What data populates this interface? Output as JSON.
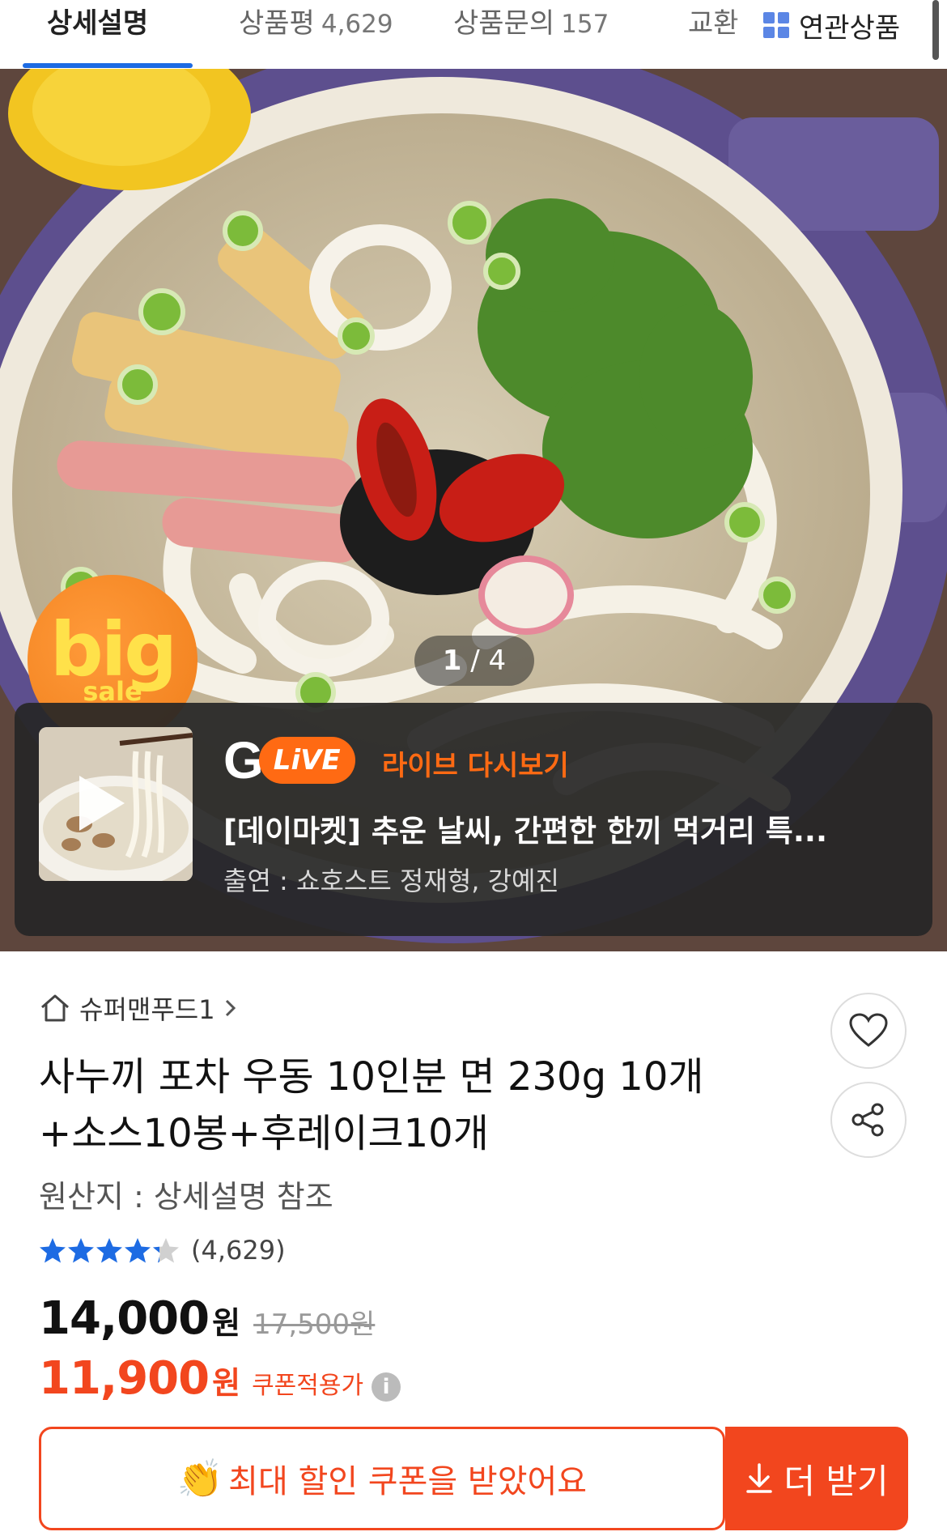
{
  "tabs": [
    {
      "label": "상세설명",
      "count": ""
    },
    {
      "label": "상품평",
      "count": "4,629"
    },
    {
      "label": "상품문의",
      "count": "157"
    },
    {
      "label": "교환",
      "count": ""
    }
  ],
  "related_label": "연관상품",
  "hero": {
    "badge_big": "big",
    "badge_sale": "sale",
    "counter_current": "1",
    "counter_sep": " / ",
    "counter_total": "4"
  },
  "live": {
    "g_letter": "G",
    "pill_text": "LiVE",
    "replay_label": "라이브 다시보기",
    "title": "[데이마켓] 추운 날씨, 간편한 한끼 먹거리 특...",
    "cast": "출연 : 쇼호스트 정재형, 강예진"
  },
  "product": {
    "store_name": "슈퍼맨푸드1",
    "title": "사누끼 포차 우동 10인분 면 230g 10개 +소스10봉+후레이크10개",
    "origin": "원산지 : 상세설명 참조",
    "rating_value": 4.5,
    "rating_count": "(4,629)",
    "price": "14,000",
    "original_price": "17,500원",
    "coupon_price": "11,900",
    "won": "원",
    "coupon_label": "쿠폰적용가",
    "info_icon": "i"
  },
  "coupon": {
    "received_text": "최대 할인 쿠폰을 받았어요",
    "more_label": "더 받기"
  },
  "colors": {
    "accent_orange": "#f2461e",
    "live_orange": "#ff6a13",
    "tab_blue": "#1d6be3",
    "star_blue": "#1d6be3"
  },
  "icons": [
    "grid-icon",
    "home-icon",
    "chevron-right-icon",
    "heart-icon",
    "share-icon",
    "play-icon",
    "star-icon",
    "info-icon",
    "clap-icon",
    "download-icon"
  ]
}
